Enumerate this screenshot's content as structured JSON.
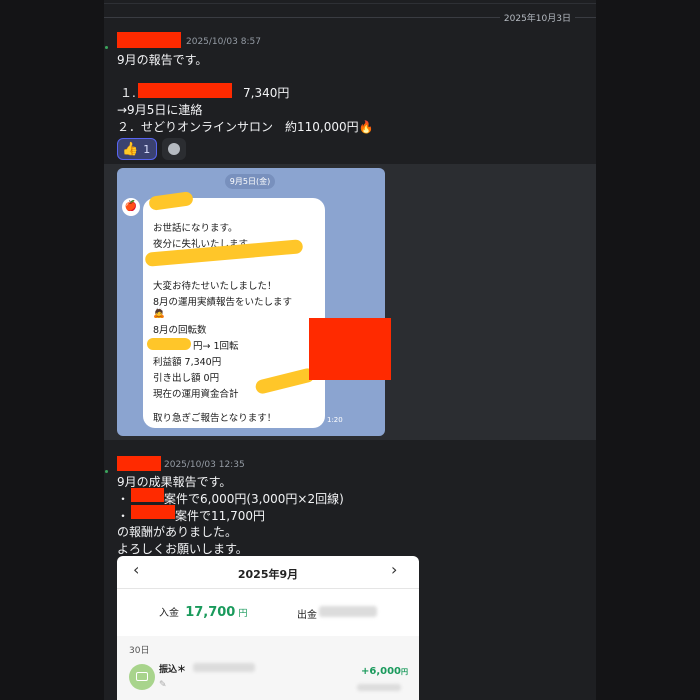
{
  "date_divider": "2025年10月3日",
  "message1": {
    "timestamp": "2025/10/03 8:57",
    "lines": [
      "9月の報告です。",
      "１.",
      "7,340円",
      "→9月5日に連絡",
      "２．せどりオンラインサロン　約110,000円"
    ],
    "reaction": {
      "emoji": "👍",
      "count": "1"
    },
    "line_screenshot": {
      "date": "9月5日(金)",
      "bubble_lines": [
        "お世話になります。",
        "夜分に失礼いたします。",
        "大変お待たせいたしました！",
        "8月の運用実績報告をいたします",
        "8月の回転数",
        "円→ 1回転",
        "利益額 7,340円",
        "引き出し額 0円",
        "現在の運用資金合計",
        "取り急ぎご報告となります！"
      ],
      "time": "1:20"
    }
  },
  "message2": {
    "timestamp": "2025/10/03 12:35",
    "lines": [
      "9月の成果報告です。",
      "・",
      "案件で6,000円(3,000円×2回線)",
      "・",
      "案件で11,700円",
      "の報酬がありました。",
      "よろしくお願いします。"
    ],
    "card": {
      "month": "2025年9月",
      "income_label": "入金",
      "income_value": "17,700",
      "income_unit": "円",
      "expense_label": "出金",
      "day": "30日",
      "entry_label": "振込＊",
      "entry_amount": "+6,000",
      "entry_unit": "円"
    }
  },
  "colors": {
    "redaction": "#ff2a00",
    "highlighter": "#ffc629",
    "accent_green": "#1a9a5c"
  }
}
